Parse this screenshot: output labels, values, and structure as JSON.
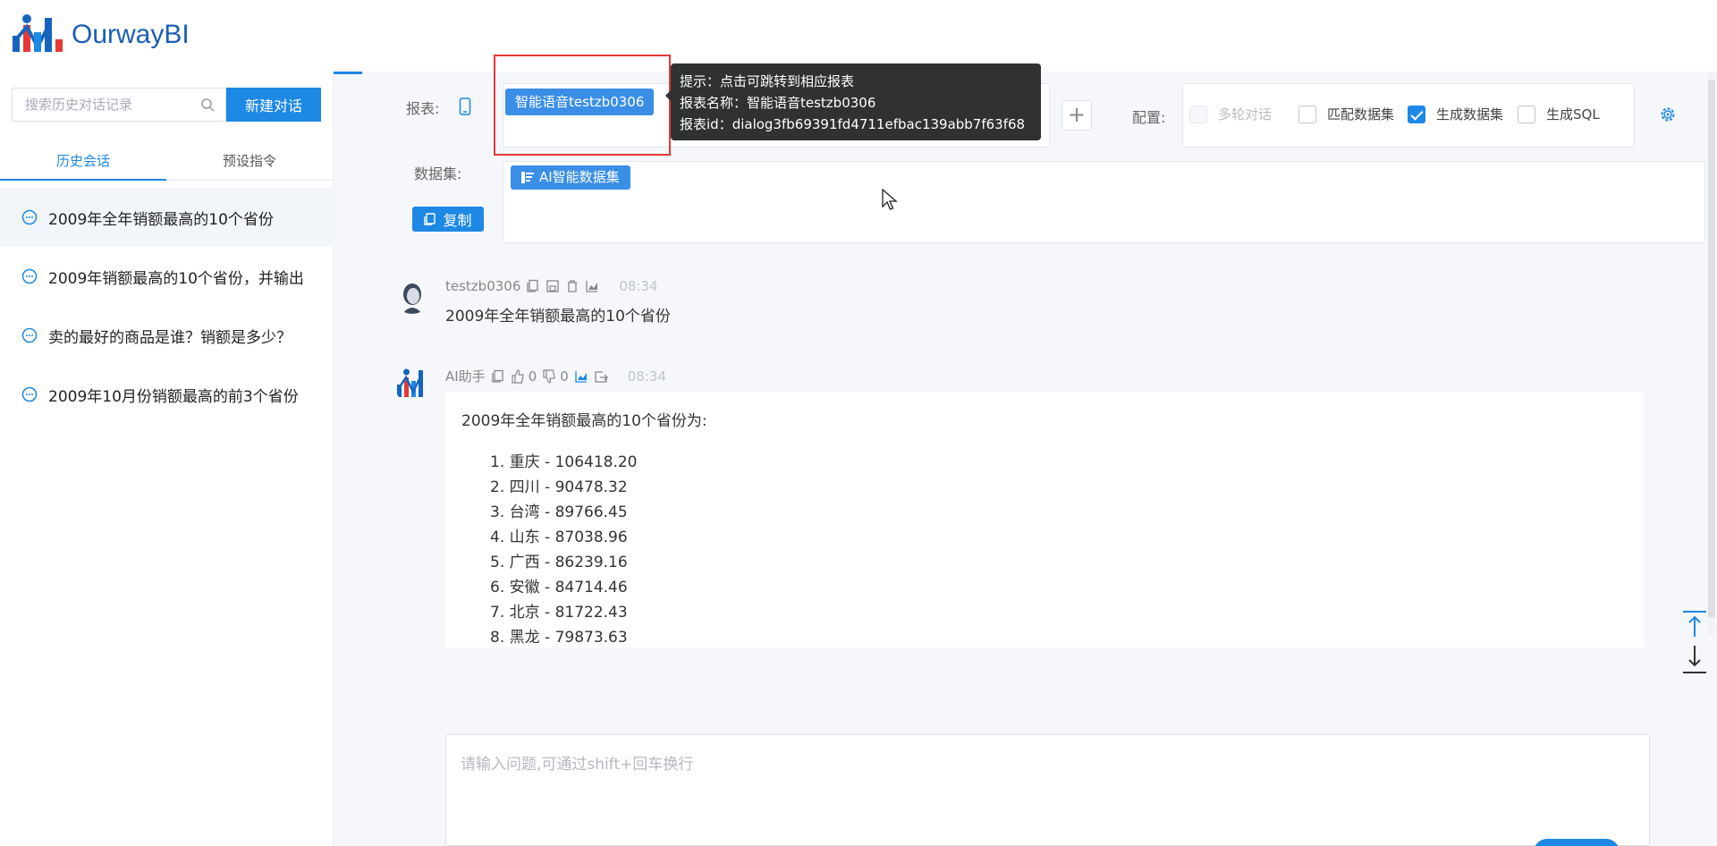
{
  "app": {
    "name": "OurwayBI"
  },
  "sidebar": {
    "search_placeholder": "搜索历史对话记录",
    "new_chat_label": "新建对话",
    "tabs": [
      {
        "label": "历史会话"
      },
      {
        "label": "预设指令"
      }
    ],
    "history": [
      {
        "title": "2009年全年销额最高的10个省份"
      },
      {
        "title": "2009年销额最高的10个省份，并输出"
      },
      {
        "title": "卖的最好的商品是谁？销额是多少？"
      },
      {
        "title": "2009年10月份销额最高的前3个省份"
      }
    ]
  },
  "toolbar": {
    "report_label": "报表:",
    "report_tag": "智能语音testzb0306",
    "tooltip": {
      "line1": "提示：点击可跳转到相应报表",
      "line2": "报表名称：智能语音testzb0306",
      "line3": "报表id：dialog3fb69391fd4711efbac139abb7f63f68"
    },
    "plus_label": "+",
    "config_label": "配置:",
    "options": [
      {
        "label": "多轮对话",
        "checked": false,
        "disabled": true
      },
      {
        "label": "匹配数据集",
        "checked": false,
        "disabled": false
      },
      {
        "label": "生成数据集",
        "checked": true,
        "disabled": false
      },
      {
        "label": "生成SQL",
        "checked": false,
        "disabled": false
      }
    ],
    "dataset_label": "数据集:",
    "dataset_tag": "AI智能数据集",
    "copy_label": "复制"
  },
  "messages": {
    "user": {
      "name": "testzb0306",
      "time": "08:34",
      "text": "2009年全年销额最高的10个省份"
    },
    "assistant": {
      "name": "AI助手",
      "likes": "0",
      "dislikes": "0",
      "time": "08:34",
      "intro": "2009年全年销额最高的10个省份为:",
      "items": [
        "1. 重庆 - 106418.20",
        "2. 四川 - 90478.32",
        "3. 台湾 - 89766.45",
        "4. 山东 - 87038.96",
        "5. 广西 - 86239.16",
        "6. 安徽 - 84714.46",
        "7. 北京 - 81722.43",
        "8. 黑龙 - 79873.63"
      ]
    }
  },
  "input": {
    "placeholder": "请输入问题,可通过shift+回车换行"
  },
  "colors": {
    "primary": "#1e88e5",
    "tag": "#3a8ee6",
    "highlight": "#e53935",
    "tooltip_bg": "#303133"
  }
}
